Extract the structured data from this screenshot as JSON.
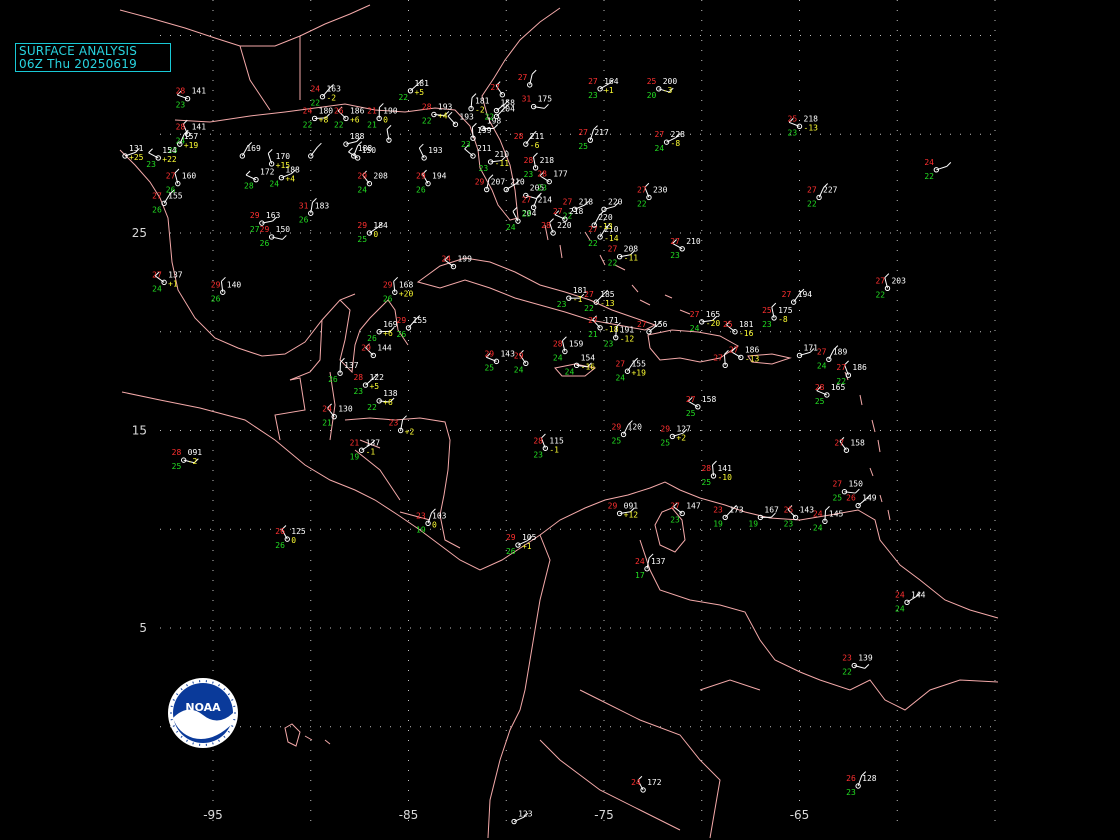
{
  "map": {
    "title_line1": "SURFACE ANALYSIS",
    "title_line2": "06Z Thu 20250619",
    "logo_text": "NOAA",
    "colors": {
      "background": "#000000",
      "coastline": "#f4a9a9",
      "grid": "#bdbdbd",
      "title": "#28d3df",
      "temperature": "#ff3030",
      "dewpoint": "#22dd22",
      "pressure": "#ffffff",
      "tendency": "#ffff33"
    },
    "latitude_labels": [
      "25",
      "15",
      "5"
    ],
    "longitude_labels": [
      "-95",
      "-85",
      "-75",
      "-65"
    ],
    "stations": [
      {
        "temp": "28",
        "dew": "23",
        "pres": "141",
        "tend": "",
        "lon": -96.3,
        "lat": 31.8
      },
      {
        "temp": "28",
        "dew": "24",
        "pres": "141",
        "tend": "",
        "lon": -96.3,
        "lat": 30.0
      },
      {
        "temp": "",
        "dew": "23",
        "pres": "157",
        "tend": "+19",
        "lon": -96.7,
        "lat": 29.5
      },
      {
        "temp": "",
        "dew": "",
        "pres": "131",
        "tend": "+25",
        "lon": -99.5,
        "lat": 28.9
      },
      {
        "temp": "",
        "dew": "23",
        "pres": "154",
        "tend": "+22",
        "lon": -97.8,
        "lat": 28.8
      },
      {
        "temp": "27",
        "dew": "26",
        "pres": "160",
        "tend": "",
        "lon": -96.8,
        "lat": 27.5
      },
      {
        "temp": "27",
        "dew": "26",
        "pres": "155",
        "tend": "",
        "lon": -97.5,
        "lat": 26.5
      },
      {
        "temp": "29",
        "dew": "27",
        "pres": "163",
        "tend": "",
        "lon": -92.5,
        "lat": 25.5
      },
      {
        "temp": "27",
        "dew": "24",
        "pres": "137",
        "tend": "+1",
        "lon": -97.5,
        "lat": 22.5
      },
      {
        "temp": "29",
        "dew": "26",
        "pres": "140",
        "tend": "",
        "lon": -94.5,
        "lat": 22.0
      },
      {
        "temp": "24",
        "dew": "22",
        "pres": "163",
        "tend": "-2",
        "lon": -89.4,
        "lat": 31.9
      },
      {
        "temp": "24",
        "dew": "22",
        "pres": "180",
        "tend": "+8",
        "lon": -89.8,
        "lat": 30.8
      },
      {
        "temp": "26",
        "dew": "22",
        "pres": "186",
        "tend": "+6",
        "lon": -88.2,
        "lat": 30.8
      },
      {
        "temp": "21",
        "dew": "21",
        "pres": "190",
        "tend": "0",
        "lon": -86.5,
        "lat": 30.8
      },
      {
        "temp": "",
        "dew": "22",
        "pres": "181",
        "tend": "+5",
        "lon": -84.9,
        "lat": 32.2
      },
      {
        "temp": "28",
        "dew": "22",
        "pres": "193",
        "tend": "+4",
        "lon": -83.7,
        "lat": 31.0
      },
      {
        "temp": "29",
        "dew": "24",
        "pres": "208",
        "tend": "",
        "lon": -87.0,
        "lat": 27.5
      },
      {
        "temp": "31",
        "dew": "26",
        "pres": "183",
        "tend": "",
        "lon": -90.0,
        "lat": 26.0
      },
      {
        "temp": "29",
        "dew": "25",
        "pres": "184",
        "tend": "0",
        "lon": -87.0,
        "lat": 25.0
      },
      {
        "temp": "29",
        "dew": "26",
        "pres": "150",
        "tend": "",
        "lon": -92.0,
        "lat": 24.8
      },
      {
        "temp": "29",
        "dew": "26",
        "pres": "194",
        "tend": "",
        "lon": -84.0,
        "lat": 27.5
      },
      {
        "temp": "27",
        "dew": "25",
        "pres": "217",
        "tend": "",
        "lon": -75.7,
        "lat": 29.7
      },
      {
        "temp": "27",
        "dew": "24",
        "pres": "228",
        "tend": "-8",
        "lon": -71.8,
        "lat": 29.6
      },
      {
        "temp": "25",
        "dew": "23",
        "pres": "218",
        "tend": "-13",
        "lon": -65.0,
        "lat": 30.4
      },
      {
        "temp": "27",
        "dew": "22",
        "pres": "230",
        "tend": "",
        "lon": -72.7,
        "lat": 26.8
      },
      {
        "temp": "27",
        "dew": "22",
        "pres": "227",
        "tend": "",
        "lon": -64.0,
        "lat": 26.8
      },
      {
        "temp": "24",
        "dew": "22",
        "pres": "",
        "tend": "",
        "lon": -58.0,
        "lat": 28.2
      },
      {
        "temp": "27",
        "dew": "23",
        "pres": "210",
        "tend": "",
        "lon": -71.0,
        "lat": 24.2
      },
      {
        "temp": "27",
        "dew": "22",
        "pres": "203",
        "tend": "",
        "lon": -60.5,
        "lat": 22.2
      },
      {
        "temp": "27",
        "dew": "22",
        "pres": "210",
        "tend": "-14",
        "lon": -75.2,
        "lat": 24.8
      },
      {
        "temp": "27",
        "dew": "22",
        "pres": "208",
        "tend": "-11",
        "lon": -74.2,
        "lat": 23.8
      },
      {
        "temp": "24",
        "dew": "",
        "pres": "199",
        "tend": "",
        "lon": -82.7,
        "lat": 23.3
      },
      {
        "temp": "29",
        "dew": "26",
        "pres": "168",
        "tend": "+20",
        "lon": -85.7,
        "lat": 22.0
      },
      {
        "temp": "29",
        "dew": "26",
        "pres": "155",
        "tend": "",
        "lon": -85.0,
        "lat": 20.2
      },
      {
        "temp": "",
        "dew": "26",
        "pres": "169",
        "tend": "+6",
        "lon": -86.5,
        "lat": 20.0
      },
      {
        "temp": "29",
        "dew": "",
        "pres": "144",
        "tend": "",
        "lon": -86.8,
        "lat": 18.8
      },
      {
        "temp": "",
        "dew": "26",
        "pres": "137",
        "tend": "",
        "lon": -88.5,
        "lat": 17.9
      },
      {
        "temp": "28",
        "dew": "23",
        "pres": "122",
        "tend": "+5",
        "lon": -87.2,
        "lat": 17.3
      },
      {
        "temp": "",
        "dew": "22",
        "pres": "138",
        "tend": "+6",
        "lon": -86.5,
        "lat": 16.5
      },
      {
        "temp": "24",
        "dew": "21",
        "pres": "130",
        "tend": "",
        "lon": -88.8,
        "lat": 15.7
      },
      {
        "temp": "23",
        "dew": "",
        "pres": "",
        "tend": "+2",
        "lon": -85.4,
        "lat": 15.0
      },
      {
        "temp": "21",
        "dew": "19",
        "pres": "137",
        "tend": "-1",
        "lon": -87.4,
        "lat": 14.0
      },
      {
        "temp": "28",
        "dew": "25",
        "pres": "091",
        "tend": "-2",
        "lon": -96.5,
        "lat": 13.5
      },
      {
        "temp": "26",
        "dew": "26",
        "pres": "125",
        "tend": "0",
        "lon": -91.2,
        "lat": 9.5
      },
      {
        "temp": "23",
        "dew": "19",
        "pres": "103",
        "tend": "0",
        "lon": -84.0,
        "lat": 10.3
      },
      {
        "temp": "29",
        "dew": "26",
        "pres": "105",
        "tend": "+1",
        "lon": -79.4,
        "lat": 9.2
      },
      {
        "temp": "29",
        "dew": "25",
        "pres": "143",
        "tend": "",
        "lon": -80.5,
        "lat": 18.5
      },
      {
        "temp": "28",
        "dew": "23",
        "pres": "115",
        "tend": "-1",
        "lon": -78.0,
        "lat": 14.1
      },
      {
        "temp": "29",
        "dew": "25",
        "pres": "120",
        "tend": "",
        "lon": -74.0,
        "lat": 14.8
      },
      {
        "temp": "29",
        "dew": "25",
        "pres": "127",
        "tend": "+2",
        "lon": -71.5,
        "lat": 14.7
      },
      {
        "temp": "27",
        "dew": "25",
        "pres": "158",
        "tend": "",
        "lon": -70.2,
        "lat": 16.2
      },
      {
        "temp": "28",
        "dew": "24",
        "pres": "159",
        "tend": "",
        "lon": -77.0,
        "lat": 19.0
      },
      {
        "temp": "27",
        "dew": "24",
        "pres": "155",
        "tend": "+19",
        "lon": -73.8,
        "lat": 18.0
      },
      {
        "temp": "29",
        "dew": "",
        "pres": "091",
        "tend": "+12",
        "lon": -74.2,
        "lat": 10.8
      },
      {
        "temp": "27",
        "dew": "23",
        "pres": "147",
        "tend": "",
        "lon": -71.0,
        "lat": 10.8
      },
      {
        "temp": "28",
        "dew": "25",
        "pres": "141",
        "tend": "-10",
        "lon": -69.4,
        "lat": 12.7
      },
      {
        "temp": "23",
        "dew": "19",
        "pres": "173",
        "tend": "",
        "lon": -68.8,
        "lat": 10.6
      },
      {
        "temp": "",
        "dew": "19",
        "pres": "167",
        "tend": "",
        "lon": -67.0,
        "lat": 10.6
      },
      {
        "temp": "25",
        "dew": "23",
        "pres": "143",
        "tend": "",
        "lon": -65.2,
        "lat": 10.6
      },
      {
        "temp": "24",
        "dew": "24",
        "pres": "145",
        "tend": "",
        "lon": -63.7,
        "lat": 10.4
      },
      {
        "temp": "26",
        "dew": "",
        "pres": "149",
        "tend": "",
        "lon": -62.0,
        "lat": 11.2
      },
      {
        "temp": "27",
        "dew": "25",
        "pres": "150",
        "tend": "",
        "lon": -62.7,
        "lat": 11.9
      },
      {
        "temp": "27",
        "dew": "",
        "pres": "158",
        "tend": "",
        "lon": -62.6,
        "lat": 14.0
      },
      {
        "temp": "24",
        "dew": "17",
        "pres": "137",
        "tend": "",
        "lon": -72.8,
        "lat": 8.0
      },
      {
        "temp": "24",
        "dew": "24",
        "pres": "144",
        "tend": "",
        "lon": -59.5,
        "lat": 6.3
      },
      {
        "temp": "23",
        "dew": "22",
        "pres": "139",
        "tend": "",
        "lon": -62.2,
        "lat": 3.1
      },
      {
        "temp": "24",
        "dew": "",
        "pres": "172",
        "tend": "",
        "lon": -73.0,
        "lat": -3.2
      },
      {
        "temp": "26",
        "dew": "23",
        "pres": "128",
        "tend": "",
        "lon": -62.0,
        "lat": -3.0
      },
      {
        "temp": "",
        "dew": "",
        "pres": "123",
        "tend": "",
        "lon": -79.6,
        "lat": -4.8
      },
      {
        "temp": "28",
        "dew": "25",
        "pres": "165",
        "tend": "",
        "lon": -63.6,
        "lat": 16.8
      },
      {
        "temp": "27",
        "dew": "22",
        "pres": "186",
        "tend": "",
        "lon": -62.5,
        "lat": 17.8
      },
      {
        "temp": "27",
        "dew": "24",
        "pres": "189",
        "tend": "",
        "lon": -63.5,
        "lat": 18.6
      },
      {
        "temp": "",
        "dew": "",
        "pres": "171",
        "tend": "",
        "lon": -65.0,
        "lat": 18.8
      },
      {
        "temp": "27",
        "dew": "",
        "pres": "186",
        "tend": "-13",
        "lon": -68.0,
        "lat": 18.7
      },
      {
        "temp": "25",
        "dew": "23",
        "pres": "175",
        "tend": "-8",
        "lon": -66.3,
        "lat": 20.7
      },
      {
        "temp": "27",
        "dew": "",
        "pres": "194",
        "tend": "",
        "lon": -65.3,
        "lat": 21.5
      },
      {
        "temp": "27",
        "dew": "24",
        "pres": "165",
        "tend": "-20",
        "lon": -70.0,
        "lat": 20.5
      },
      {
        "temp": "25",
        "dew": "",
        "pres": "181",
        "tend": "-16",
        "lon": -68.3,
        "lat": 20.0
      },
      {
        "temp": "27",
        "dew": "",
        "pres": "",
        "tend": "",
        "lon": -68.8,
        "lat": 18.3
      },
      {
        "temp": "27",
        "dew": "22",
        "pres": "185",
        "tend": "-13",
        "lon": -75.4,
        "lat": 21.5
      },
      {
        "temp": "",
        "dew": "23",
        "pres": "181",
        "tend": "-1",
        "lon": -76.8,
        "lat": 21.7
      },
      {
        "temp": "27",
        "dew": "21",
        "pres": "171",
        "tend": "-18",
        "lon": -75.2,
        "lat": 20.2
      },
      {
        "temp": "",
        "dew": "23",
        "pres": "191",
        "tend": "-12",
        "lon": -74.4,
        "lat": 19.7
      },
      {
        "temp": "27",
        "dew": "",
        "pres": "156",
        "tend": "",
        "lon": -72.7,
        "lat": 20.0
      },
      {
        "temp": "",
        "dew": "24",
        "pres": "154",
        "tend": "-16",
        "lon": -76.4,
        "lat": 18.3
      },
      {
        "temp": "29",
        "dew": "24",
        "pres": "",
        "tend": "",
        "lon": -79.0,
        "lat": 18.4
      },
      {
        "temp": "29",
        "dew": "",
        "pres": "207",
        "tend": "",
        "lon": -81.0,
        "lat": 27.2
      },
      {
        "temp": "",
        "dew": "",
        "pres": "210",
        "tend": "",
        "lon": -80.0,
        "lat": 27.2
      },
      {
        "temp": "",
        "dew": "",
        "pres": "205",
        "tend": "",
        "lon": -79.0,
        "lat": 26.9
      },
      {
        "temp": "",
        "dew": "24",
        "pres": "204",
        "tend": "",
        "lon": -79.4,
        "lat": 25.6
      },
      {
        "temp": "27",
        "dew": "23",
        "pres": "214",
        "tend": "",
        "lon": -78.6,
        "lat": 26.3
      },
      {
        "temp": "27",
        "dew": "22",
        "pres": "218",
        "tend": "",
        "lon": -76.5,
        "lat": 26.2
      },
      {
        "temp": "27",
        "dew": "",
        "pres": "218",
        "tend": "",
        "lon": -77.0,
        "lat": 25.7
      },
      {
        "temp": "28",
        "dew": "",
        "pres": "220",
        "tend": "",
        "lon": -77.6,
        "lat": 25.0
      },
      {
        "temp": "",
        "dew": "",
        "pres": "220",
        "tend": "-13",
        "lon": -75.5,
        "lat": 25.4
      },
      {
        "temp": "",
        "dew": "",
        "pres": "220",
        "tend": "",
        "lon": -75.0,
        "lat": 26.2
      },
      {
        "temp": "28",
        "dew": "23",
        "pres": "177",
        "tend": "",
        "lon": -77.8,
        "lat": 27.6
      },
      {
        "temp": "28",
        "dew": "23",
        "pres": "218",
        "tend": "",
        "lon": -78.5,
        "lat": 28.3
      },
      {
        "temp": "28",
        "dew": "",
        "pres": "211",
        "tend": "-6",
        "lon": -79.0,
        "lat": 29.5
      },
      {
        "temp": "",
        "dew": "23",
        "pres": "210",
        "tend": "-11",
        "lon": -80.8,
        "lat": 28.6
      },
      {
        "temp": "",
        "dew": "",
        "pres": "211",
        "tend": "",
        "lon": -81.7,
        "lat": 28.9
      },
      {
        "temp": "",
        "dew": "23",
        "pres": "199",
        "tend": "",
        "lon": -81.7,
        "lat": 29.8
      },
      {
        "temp": "",
        "dew": "",
        "pres": "204",
        "tend": "",
        "lon": -80.5,
        "lat": 30.9
      },
      {
        "temp": "",
        "dew": "",
        "pres": "198",
        "tend": "",
        "lon": -81.2,
        "lat": 30.3
      },
      {
        "temp": "",
        "dew": "",
        "pres": "193",
        "tend": "",
        "lon": -82.6,
        "lat": 30.5
      },
      {
        "temp": "",
        "dew": "",
        "pres": "181",
        "tend": "-2",
        "lon": -81.8,
        "lat": 31.3
      },
      {
        "temp": "",
        "dew": "22",
        "pres": "158",
        "tend": "",
        "lon": -80.5,
        "lat": 31.2
      },
      {
        "temp": "31",
        "dew": "",
        "pres": "175",
        "tend": "",
        "lon": -78.6,
        "lat": 31.4
      },
      {
        "temp": "27",
        "dew": "",
        "pres": "",
        "tend": "",
        "lon": -80.2,
        "lat": 32.0
      },
      {
        "temp": "27",
        "dew": "",
        "pres": "",
        "tend": "",
        "lon": -78.8,
        "lat": 32.5
      },
      {
        "temp": "27",
        "dew": "23",
        "pres": "164",
        "tend": "+1",
        "lon": -75.2,
        "lat": 32.3
      },
      {
        "temp": "25",
        "dew": "20",
        "pres": "200",
        "tend": "-3",
        "lon": -72.2,
        "lat": 32.3
      },
      {
        "temp": "",
        "dew": "",
        "pres": "193",
        "tend": "",
        "lon": -84.2,
        "lat": 28.8
      },
      {
        "temp": "",
        "dew": "",
        "pres": "188",
        "tend": "",
        "lon": -87.8,
        "lat": 28.9
      },
      {
        "temp": "",
        "dew": "24",
        "pres": "188",
        "tend": "+4",
        "lon": -91.5,
        "lat": 27.8
      },
      {
        "temp": "",
        "dew": "28",
        "pres": "172",
        "tend": "",
        "lon": -92.8,
        "lat": 27.7
      },
      {
        "temp": "",
        "dew": "",
        "pres": "170",
        "tend": "+15",
        "lon": -92.0,
        "lat": 28.5
      },
      {
        "temp": "",
        "dew": "",
        "pres": "169",
        "tend": "",
        "lon": -93.5,
        "lat": 28.9
      },
      {
        "temp": "",
        "dew": "",
        "pres": "188",
        "tend": "",
        "lon": -88.2,
        "lat": 29.5
      },
      {
        "temp": "",
        "dew": "",
        "pres": "150",
        "tend": "",
        "lon": -87.6,
        "lat": 28.8
      },
      {
        "temp": "",
        "dew": "",
        "pres": "",
        "tend": "",
        "lon": -86.0,
        "lat": 29.7
      },
      {
        "temp": "",
        "dew": "",
        "pres": "",
        "tend": "",
        "lon": -90.0,
        "lat": 28.9
      }
    ]
  }
}
